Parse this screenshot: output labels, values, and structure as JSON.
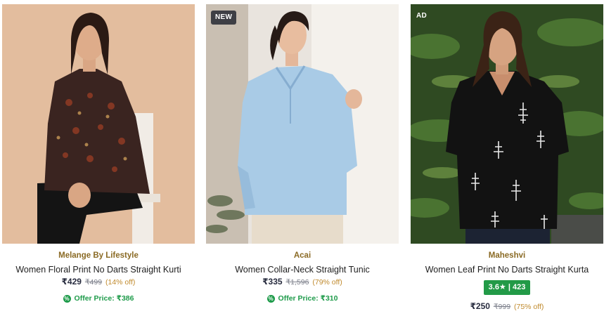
{
  "products": [
    {
      "tag": "",
      "brand": "Melange By Lifestyle",
      "title": "Women Floral Print No Darts Straight Kurti",
      "price": "₹429",
      "mrp": "₹499",
      "discount": "(14% off)",
      "offer_label": "Offer Price: ₹386",
      "offer_icon": "percent-badge-icon"
    },
    {
      "tag": "NEW",
      "brand": "Acai",
      "title": "Women Collar-Neck Straight Tunic",
      "price": "₹335",
      "mrp": "₹1,596",
      "discount": "(79% off)",
      "offer_label": "Offer Price: ₹310",
      "offer_icon": "percent-badge-icon"
    },
    {
      "tag": "AD",
      "brand": "Maheshvi",
      "title": "Women Leaf Print No Darts Straight Kurta",
      "rating": "3.6★ | 423",
      "price": "₹250",
      "mrp": "₹999",
      "discount": "(75% off)"
    }
  ],
  "colors": {
    "brand_text": "#8a6a24",
    "discount_text": "#c08a2d",
    "offer_green": "#1e9b4a",
    "rating_bg": "#229a47",
    "new_tag_bg": "#3e3f45"
  }
}
